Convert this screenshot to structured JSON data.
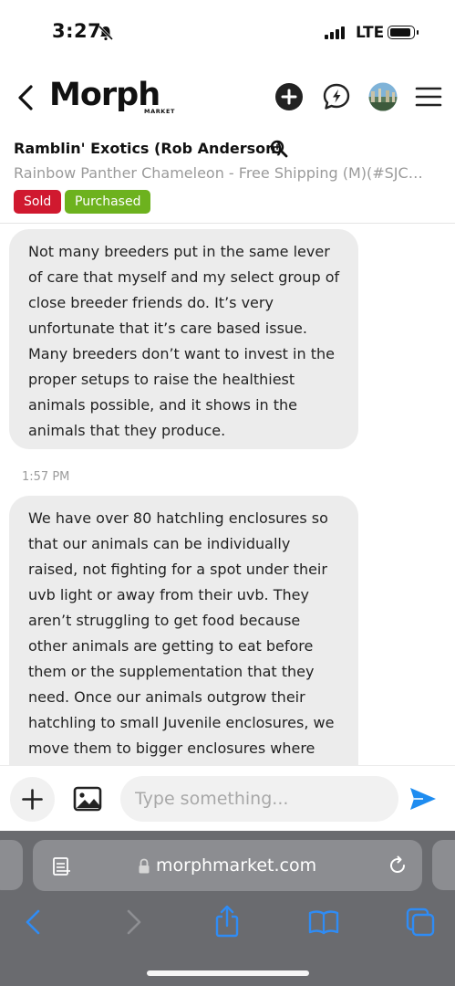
{
  "status_bar": {
    "time": "3:27",
    "network": "LTE"
  },
  "header": {
    "logo_text": "Morph",
    "logo_sub": "MARKET"
  },
  "listing": {
    "seller": "Ramblin' Exotics (Rob Anderson)",
    "title": "Rainbow Panther Chameleon - Free Shipping (M)(#SJC…",
    "badges": {
      "sold": "Sold",
      "purchased": "Purchased"
    }
  },
  "messages": [
    {
      "text": "Not many breeders put in the same lever of care that myself and my select group of close breeder friends do. It’s very unfortunate that it’s care based issue. Many breeders don’t want to invest in the proper setups to raise the healthiest animals possible, and it shows in the animals that they produce."
    },
    {
      "timestamp": "1:57 PM",
      "text": "We have over 80 hatchling enclosures so that our animals can be individually raised, not fighting for a spot under their uvb light or away from their uvb. They aren’t struggling to get food because other animals are getting to eat before them or the supplementation that they need. Once our animals outgrow their hatchling to small Juvenile enclosures, we move them to bigger enclosures where they can"
    }
  ],
  "composer": {
    "placeholder": "Type something...",
    "value": ""
  },
  "browser": {
    "url": "morphmarket.com"
  },
  "colors": {
    "sold": "#d0192f",
    "purchased": "#6db21e",
    "send": "#1e8cf0",
    "safari_bg": "#6a6b6f"
  },
  "icons": {
    "header": [
      "back-chevron-icon",
      "plus-circle-icon",
      "chat-bolt-icon",
      "avatar",
      "menu-icon"
    ],
    "composer": [
      "plus-icon",
      "image-icon",
      "send-icon"
    ],
    "safari": [
      "page-settings-icon",
      "lock-icon",
      "reload-icon",
      "back-icon",
      "forward-icon",
      "share-icon",
      "bookmarks-icon",
      "tabs-icon"
    ]
  }
}
